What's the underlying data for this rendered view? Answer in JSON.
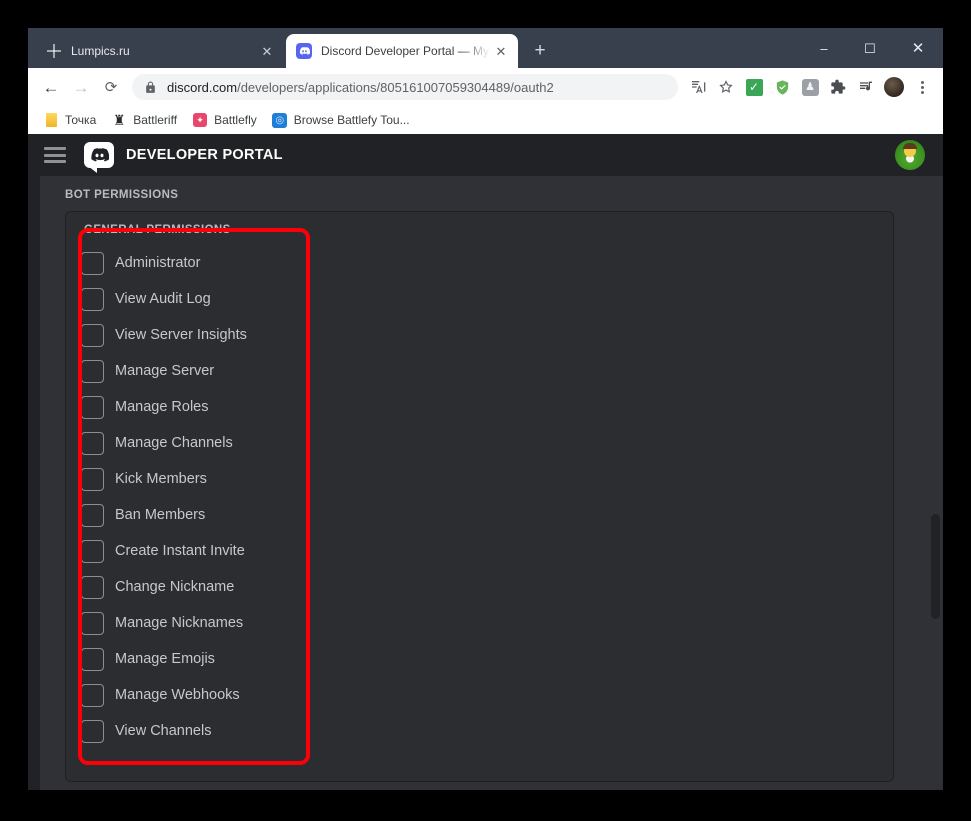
{
  "browser": {
    "tabs": [
      {
        "title": "Lumpics.ru",
        "favicon": "orange-slice-icon",
        "active": false,
        "close_label": "✕"
      },
      {
        "title": "Discord Developer Portal — My A",
        "favicon": "discord-icon",
        "active": true,
        "close_label": "✕"
      }
    ],
    "new_tab_label": "+",
    "window_controls": {
      "minimize": "–",
      "maximize": "☐",
      "close": "✕"
    },
    "nav": {
      "back": "←",
      "forward": "→",
      "reload": "⟳"
    },
    "omnibox": {
      "url_host": "discord.com",
      "url_path": "/developers/applications/805161007059304489/oauth2",
      "lock_icon": "lock-icon"
    },
    "omnibox_icons": [
      {
        "name": "translate-icon",
        "glyph": "語"
      },
      {
        "name": "bookmark-star-icon",
        "glyph": "☆"
      },
      {
        "name": "extension-checkmark-icon",
        "glyph": "✔"
      },
      {
        "name": "adblock-shield-icon",
        "glyph": "✔"
      },
      {
        "name": "extension-gray-icon",
        "glyph": "♟"
      },
      {
        "name": "extensions-puzzle-icon",
        "glyph": "❖"
      },
      {
        "name": "playlist-music-icon",
        "glyph": "♫"
      },
      {
        "name": "profile-avatar-icon",
        "glyph": ""
      },
      {
        "name": "chrome-menu-icon",
        "glyph": "⋮"
      }
    ],
    "bookmarks": [
      {
        "label": "Точка",
        "icon": "tochka-icon"
      },
      {
        "label": "Battleriff",
        "icon": "battleriff-icon",
        "glyph": "♜"
      },
      {
        "label": "Battlefly",
        "icon": "battlefly-icon",
        "glyph": "❀"
      },
      {
        "label": "Browse Battlefy Tou...",
        "icon": "battlefy-icon",
        "glyph": "◎"
      }
    ]
  },
  "discord": {
    "header": {
      "menu_icon": "hamburger-menu-icon",
      "logo_icon": "discord-logo-icon",
      "title": "DEVELOPER PORTAL",
      "avatar_icon": "user-avatar"
    },
    "section_label": "BOT PERMISSIONS",
    "permissions_group": {
      "title": "GENERAL PERMISSIONS",
      "items": [
        {
          "label": "Administrator",
          "checked": false
        },
        {
          "label": "View Audit Log",
          "checked": false
        },
        {
          "label": "View Server Insights",
          "checked": false
        },
        {
          "label": "Manage Server",
          "checked": false
        },
        {
          "label": "Manage Roles",
          "checked": false
        },
        {
          "label": "Manage Channels",
          "checked": false
        },
        {
          "label": "Kick Members",
          "checked": false
        },
        {
          "label": "Ban Members",
          "checked": false
        },
        {
          "label": "Create Instant Invite",
          "checked": false
        },
        {
          "label": "Change Nickname",
          "checked": false
        },
        {
          "label": "Manage Nicknames",
          "checked": false
        },
        {
          "label": "Manage Emojis",
          "checked": false
        },
        {
          "label": "Manage Webhooks",
          "checked": false
        },
        {
          "label": "View Channels",
          "checked": false
        }
      ]
    }
  },
  "annotation": {
    "highlight_color": "#fb0007"
  },
  "colors": {
    "discord_blurple": "#5865f2",
    "header_dark": "#202225",
    "page_bg": "#2f3136",
    "card_bg": "#2b2d31",
    "text_muted": "#b9bbbe",
    "text_body": "#c4c9ce"
  }
}
